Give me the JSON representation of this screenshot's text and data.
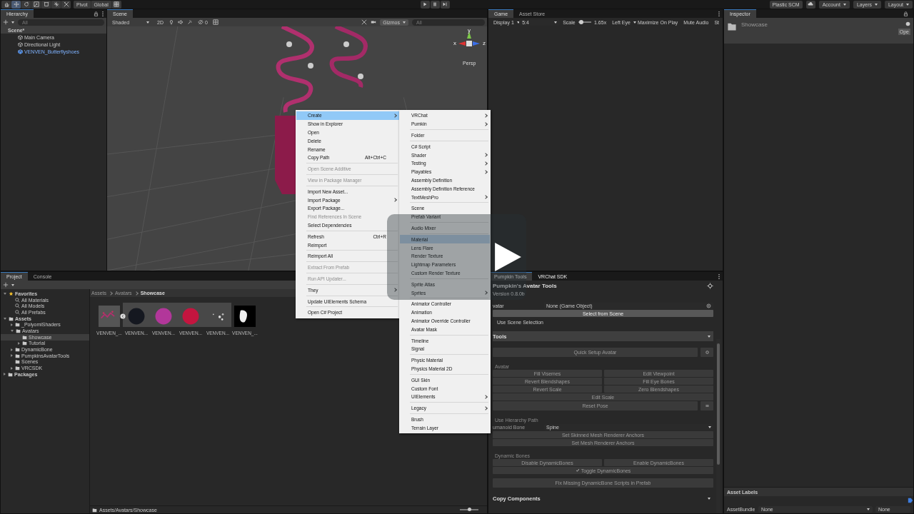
{
  "toolbar": {
    "tools": [
      {
        "selected": false
      },
      {
        "selected": true
      },
      {
        "selected": false
      },
      {
        "selected": false
      },
      {
        "selected": false
      },
      {
        "selected": false
      },
      {
        "selected": false
      }
    ],
    "pivot": "Pivot",
    "global": "Global",
    "plastic_scm": "Plastic SCM",
    "account": "Account",
    "layers": "Layers",
    "layout": "Layout"
  },
  "hierarchy": {
    "tab": "Hierarchy",
    "search_placeholder": "All",
    "scene": "Scene*",
    "items": [
      {
        "label": "Main Camera",
        "kind": "object"
      },
      {
        "label": "Directional Light",
        "kind": "object"
      },
      {
        "label": "VENVEN_Butterflyshoes",
        "kind": "prefab"
      }
    ]
  },
  "scene_view": {
    "tab": "Scene",
    "shading": "Shaded",
    "mode_2d": "2D",
    "hidden_count": "0",
    "gizmos": "Gizmos",
    "search_placeholder": "All",
    "axes": [
      "y",
      "x",
      "z"
    ],
    "projection": "Persp"
  },
  "game_view": {
    "tabs": [
      {
        "label": "Game",
        "selected": true
      },
      {
        "label": "Asset Store",
        "selected": false
      }
    ],
    "display": "Display 1",
    "aspect": "5:4",
    "scale_label": "Scale",
    "scale_slider": {
      "level": 0.25
    },
    "scale": "1.65x",
    "eye": "Left Eye",
    "maximize": "Maximize On Play",
    "mute": "Mute Audio",
    "stats": "St"
  },
  "inspector": {
    "tab": "Inspector",
    "title": "Showcase",
    "open": "Ope",
    "asset_labels": "Asset Labels",
    "assetbundle_label": "AssetBundle",
    "assetbundle": "None",
    "variant": "None"
  },
  "project": {
    "tabs": [
      {
        "label": "Project",
        "selected": true
      },
      {
        "label": "Console",
        "selected": false
      }
    ],
    "tree": [
      {
        "label": "Favorites",
        "kind": "favorites",
        "expanded": true,
        "selected": false,
        "children": [
          {
            "label": "All Materials",
            "kind": "search",
            "selected": false
          },
          {
            "label": "All Models",
            "kind": "search",
            "selected": false
          },
          {
            "label": "All Prefabs",
            "kind": "search",
            "selected": false
          }
        ]
      },
      {
        "label": "Assets",
        "kind": "root",
        "expanded": true,
        "selected": false,
        "children": [
          {
            "label": "_PoiyomiShaders",
            "kind": "folder",
            "expanded": false,
            "selected": false
          },
          {
            "label": "Avatars",
            "kind": "folder",
            "expanded": true,
            "selected": false,
            "children": [
              {
                "label": "Showcase",
                "kind": "folder",
                "selected": true
              },
              {
                "label": "Tutorial",
                "kind": "folder",
                "expanded": false,
                "selected": false
              }
            ]
          },
          {
            "label": "DynamicBone",
            "kind": "folder",
            "expanded": false,
            "selected": false
          },
          {
            "label": "PumpkinsAvatarTools",
            "kind": "folder",
            "expanded": false,
            "selected": false
          },
          {
            "label": "Scenes",
            "kind": "folder",
            "selected": false
          },
          {
            "label": "VRCSDK",
            "kind": "folder",
            "expanded": false,
            "selected": false
          }
        ]
      },
      {
        "label": "Packages",
        "kind": "root",
        "expanded": false,
        "selected": false
      }
    ],
    "breadcrumb": [
      "Assets",
      "Avatars",
      "Showcase"
    ],
    "assets": [
      {
        "name": "VENVEN_...",
        "kind": "particles",
        "expanded": true,
        "nested": false
      },
      {
        "name": "VENVEN...",
        "kind": "sphere",
        "color": "#151820",
        "nested": true
      },
      {
        "name": "VENVEN...",
        "kind": "sphere",
        "color": "#b2379a",
        "nested": true
      },
      {
        "name": "VENVEN...",
        "kind": "sphere",
        "color": "#c4153f",
        "nested": true
      },
      {
        "name": "VENVEN...",
        "kind": "sparkle",
        "nested": true
      },
      {
        "name": "VENVEN_...",
        "kind": "texture",
        "nested": false
      }
    ],
    "path": "Assets/Avatars/Showcase",
    "size_slider": {
      "level": 0.5
    }
  },
  "context_menu": {
    "groups": [
      [
        {
          "label": "Create",
          "submenu": true,
          "selected": true,
          "disabled": false
        },
        {
          "label": "Show in Explorer",
          "submenu": false,
          "selected": false,
          "disabled": false
        },
        {
          "label": "Open",
          "submenu": false,
          "selected": false,
          "disabled": false
        },
        {
          "label": "Delete",
          "submenu": false,
          "selected": false,
          "disabled": false
        },
        {
          "label": "Rename",
          "submenu": false,
          "selected": false,
          "disabled": false
        },
        {
          "label": "Copy Path",
          "shortcut": "Alt+Ctrl+C",
          "submenu": false,
          "selected": false,
          "disabled": false
        }
      ],
      [
        {
          "label": "Open Scene Additive",
          "submenu": false,
          "selected": false,
          "disabled": true
        }
      ],
      [
        {
          "label": "View in Package Manager",
          "submenu": false,
          "selected": false,
          "disabled": true
        }
      ],
      [
        {
          "label": "Import New Asset...",
          "submenu": false,
          "selected": false,
          "disabled": false
        },
        {
          "label": "Import Package",
          "submenu": true,
          "selected": false,
          "disabled": false
        },
        {
          "label": "Export Package...",
          "submenu": false,
          "selected": false,
          "disabled": false
        },
        {
          "label": "Find References In Scene",
          "submenu": false,
          "selected": false,
          "disabled": true
        },
        {
          "label": "Select Dependencies",
          "submenu": false,
          "selected": false,
          "disabled": false
        }
      ],
      [
        {
          "label": "Refresh",
          "shortcut": "Ctrl+R",
          "submenu": false,
          "selected": false,
          "disabled": false
        },
        {
          "label": "Reimport",
          "submenu": false,
          "selected": false,
          "disabled": false
        }
      ],
      [
        {
          "label": "Reimport All",
          "submenu": false,
          "selected": false,
          "disabled": false
        }
      ],
      [
        {
          "label": "Extract From Prefab",
          "submenu": false,
          "selected": false,
          "disabled": true
        }
      ],
      [
        {
          "label": "Run API Updater...",
          "submenu": false,
          "selected": false,
          "disabled": true
        }
      ],
      [
        {
          "label": "They",
          "submenu": true,
          "selected": false,
          "disabled": false
        }
      ],
      [
        {
          "label": "Update UIElements Schema",
          "submenu": false,
          "selected": false,
          "disabled": false
        }
      ],
      [
        {
          "label": "Open C# Project",
          "submenu": false,
          "selected": false,
          "disabled": false
        }
      ]
    ]
  },
  "create_submenu": {
    "groups": [
      [
        {
          "label": "VRChat",
          "submenu": true,
          "selected": false,
          "disabled": false
        },
        {
          "label": "Pumkin",
          "submenu": true,
          "selected": false,
          "disabled": false
        }
      ],
      [
        {
          "label": "Folder",
          "submenu": false,
          "selected": false,
          "disabled": false
        }
      ],
      [
        {
          "label": "C# Script",
          "submenu": false,
          "selected": false,
          "disabled": false
        },
        {
          "label": "Shader",
          "submenu": true,
          "selected": false,
          "disabled": false
        },
        {
          "label": "Testing",
          "submenu": true,
          "selected": false,
          "disabled": false
        },
        {
          "label": "Playables",
          "submenu": true,
          "selected": false,
          "disabled": false
        },
        {
          "label": "Assembly Definition",
          "submenu": false,
          "selected": false,
          "disabled": false
        },
        {
          "label": "Assembly Definition Reference",
          "submenu": false,
          "selected": false,
          "disabled": false
        },
        {
          "label": "TextMeshPro",
          "submenu": true,
          "selected": false,
          "disabled": false
        }
      ],
      [
        {
          "label": "Scene",
          "submenu": false,
          "selected": false,
          "disabled": false
        },
        {
          "label": "Prefab Variant",
          "submenu": false,
          "selected": false,
          "disabled": false
        }
      ],
      [
        {
          "label": "Audio Mixer",
          "submenu": false,
          "selected": false,
          "disabled": false
        }
      ],
      [
        {
          "label": "Material",
          "submenu": false,
          "selected": true,
          "disabled": false
        },
        {
          "label": "Lens Flare",
          "submenu": false,
          "selected": false,
          "disabled": false
        },
        {
          "label": "Render Texture",
          "submenu": false,
          "selected": false,
          "disabled": false
        },
        {
          "label": "Lightmap Parameters",
          "submenu": false,
          "selected": false,
          "disabled": false
        },
        {
          "label": "Custom Render Texture",
          "submenu": false,
          "selected": false,
          "disabled": false
        }
      ],
      [
        {
          "label": "Sprite Atlas",
          "submenu": false,
          "selected": false,
          "disabled": false
        },
        {
          "label": "Sprites",
          "submenu": true,
          "selected": false,
          "disabled": false
        }
      ],
      [
        {
          "label": "Animator Controller",
          "submenu": false,
          "selected": false,
          "disabled": false
        },
        {
          "label": "Animation",
          "submenu": false,
          "selected": false,
          "disabled": false
        },
        {
          "label": "Animator Override Controller",
          "submenu": false,
          "selected": false,
          "disabled": false
        },
        {
          "label": "Avatar Mask",
          "submenu": false,
          "selected": false,
          "disabled": false
        }
      ],
      [
        {
          "label": "Timeline",
          "submenu": false,
          "selected": false,
          "disabled": false
        },
        {
          "label": "Signal",
          "submenu": false,
          "selected": false,
          "disabled": false
        }
      ],
      [
        {
          "label": "Physic Material",
          "submenu": false,
          "selected": false,
          "disabled": false
        },
        {
          "label": "Physics Material 2D",
          "submenu": false,
          "selected": false,
          "disabled": false
        }
      ],
      [
        {
          "label": "GUI Skin",
          "submenu": false,
          "selected": false,
          "disabled": false
        },
        {
          "label": "Custom Font",
          "submenu": false,
          "selected": false,
          "disabled": false
        },
        {
          "label": "UIElements",
          "submenu": true,
          "selected": false,
          "disabled": false
        }
      ],
      [
        {
          "label": "Legacy",
          "submenu": true,
          "selected": false,
          "disabled": false
        }
      ],
      [
        {
          "label": "Brush",
          "submenu": false,
          "selected": false,
          "disabled": false
        },
        {
          "label": "Terrain Layer",
          "submenu": false,
          "selected": false,
          "disabled": false
        }
      ]
    ]
  },
  "pumpkin_tools": {
    "tabs": [
      {
        "label": "Pumpkin Tools",
        "selected": true
      },
      {
        "label": "VRChat SDK",
        "selected": false
      }
    ],
    "title": "Pumpkin's Avatar Tools",
    "version": "Version 0.8.0b",
    "avatar_label": "vatar",
    "avatar_field": "None (Game Object)",
    "select_from_scene": "Select from Scene",
    "use_scene_selection": "Use Scene Selection",
    "tools_header": "Tools",
    "quick_setup": "Quick Setup Avatar",
    "avatar_section": "Avatar",
    "avatar_buttons": [
      "Fill Visemes",
      "Edit Viewpoint",
      "Revert Blendshapes",
      "Fill Eye Bones",
      "Revert Scale",
      "Zero Blendshapes"
    ],
    "edit_scale": "Edit Scale",
    "reset_pose": "Reset Pose",
    "use_hierarchy_path": "Use Hierarchy Path",
    "humanoid_bone_label": "umanoid Bone",
    "humanoid_bone": "Spine",
    "set_skinned": "Set Skinned Mesh Renderer Anchors",
    "set_mesh": "Set Mesh Renderer Anchors",
    "dynamic_bones": "Dynamic Bones",
    "disable_db": "Disable DynamicBones",
    "enable_db": "Enable DynamicBones",
    "toggle_db": {
      "label": "Toggle DynamicBones",
      "checked": true
    },
    "fix_missing": "Fix Missing DynamicBone Scripts in Prefab",
    "copy_components": "Copy Components"
  }
}
